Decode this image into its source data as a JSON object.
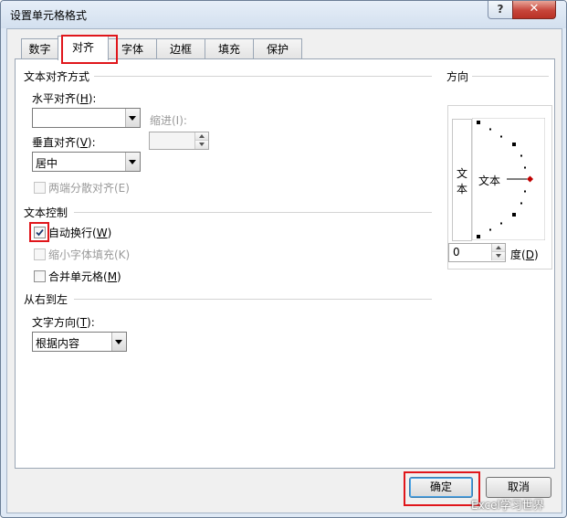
{
  "window": {
    "title": "设置单元格格式",
    "help": "?",
    "close": "✕"
  },
  "tabs": [
    "数字",
    "对齐",
    "字体",
    "边框",
    "填充",
    "保护"
  ],
  "alignment": {
    "heading": "文本对齐方式",
    "horizontal_label": "水平对齐(",
    "horizontal_key": "H",
    "horizontal_value": "",
    "indent_label": "缩进(I):",
    "indent_value": "",
    "vertical_label": "垂直对齐(",
    "vertical_key": "V",
    "vertical_value": "居中",
    "distributed_label": "两端分散对齐(E)"
  },
  "text_control": {
    "heading": "文本控制",
    "wrap_label": "自动换行(",
    "wrap_key": "W",
    "wrap_checked": true,
    "shrink_label": "缩小字体填充(K)",
    "merge_label": "合并单元格(",
    "merge_key": "M"
  },
  "rtl": {
    "heading": "从右到左",
    "direction_label": "文字方向(",
    "direction_key": "T",
    "direction_value": "根据内容"
  },
  "orientation": {
    "heading": "方向",
    "vertical_text": [
      "文",
      "本"
    ],
    "dial_text": "文本",
    "degrees_value": "0",
    "degrees_label": "度(",
    "degrees_key": "D"
  },
  "buttons": {
    "ok": "确定",
    "cancel": "取消"
  },
  "watermark": "Excel学习世界",
  "colors": {
    "highlight": "#e0161b",
    "dial_dot": "#000000",
    "dial_pointer": "#c00000"
  }
}
